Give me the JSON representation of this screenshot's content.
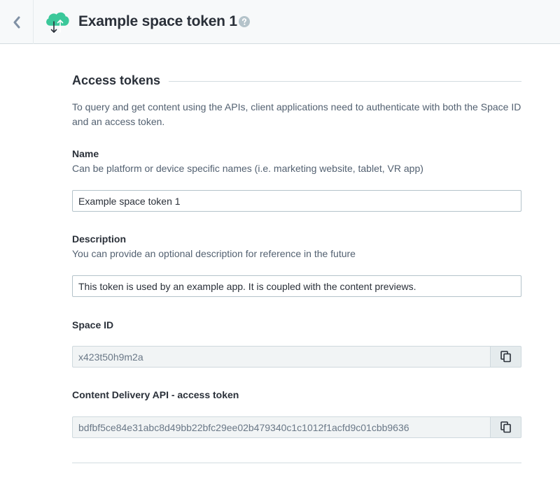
{
  "header": {
    "title": "Example space token 1",
    "back_icon": "chevron-left-icon",
    "entity_icon": "cloud-sync-icon",
    "help_icon": "question-circle-icon"
  },
  "section": {
    "heading": "Access tokens",
    "intro": "To query and get content using the APIs, client applications need to authenticate with both the Space ID and an access token."
  },
  "fields": {
    "name": {
      "label": "Name",
      "hint": "Can be platform or device specific names (i.e. marketing website, tablet, VR app)",
      "value": "Example space token 1"
    },
    "description": {
      "label": "Description",
      "hint": "You can provide an optional description for reference in the future",
      "value": "This token is used by an example app. It is coupled with the content previews."
    },
    "space_id": {
      "label": "Space ID",
      "value": "x423t50h9m2a",
      "copy_icon": "copy-icon"
    },
    "cda_token": {
      "label": "Content Delivery API - access token",
      "value": "bdfbf5ce84e31abc8d49bb22bfc29ee02b479340c1c1012f1acfd9c01cbb9636",
      "copy_icon": "copy-icon"
    }
  },
  "colors": {
    "brand_green": "#3bc89a",
    "text_dark": "#2a3039",
    "text_muted": "#536171",
    "border": "#b4c3ca",
    "readonly_bg": "#f1f4f5"
  }
}
